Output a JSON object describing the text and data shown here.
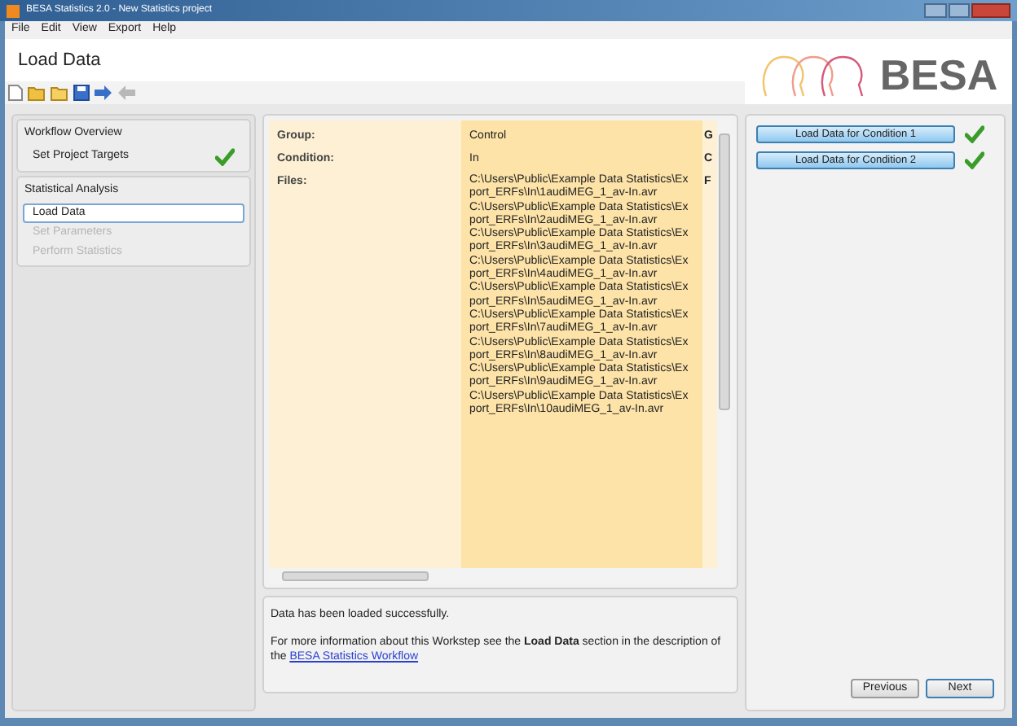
{
  "window": {
    "title": "BESA Statistics 2.0 - New Statistics project"
  },
  "menu": [
    "File",
    "Edit",
    "View",
    "Export",
    "Help"
  ],
  "header": {
    "title": "Load Data",
    "logo": "BESA"
  },
  "sidebar": [
    {
      "label": "Workflow Overview",
      "items": [
        {
          "label": "Set Project Targets",
          "selected": false,
          "disabled": false,
          "done": true
        }
      ]
    },
    {
      "label": "Statistical Analysis",
      "items": [
        {
          "label": "Load Data",
          "selected": true,
          "disabled": false,
          "done": false
        },
        {
          "label": "Set Parameters",
          "selected": false,
          "disabled": true,
          "done": false
        },
        {
          "label": "Perform Statistics",
          "selected": false,
          "disabled": true,
          "done": false
        }
      ]
    }
  ],
  "table": {
    "rows": [
      {
        "label": "Group:",
        "value": "Control",
        "column_3": "G"
      },
      {
        "label": "Condition:",
        "value": "In",
        "column_3": "C"
      },
      {
        "label": "Files:",
        "files": [
          "C:\\Users\\Public\\Example Data Statistics\\Export_ERFs\\In\\1audiMEG_1_av-In.avr",
          "C:\\Users\\Public\\Example Data Statistics\\Export_ERFs\\In\\2audiMEG_1_av-In.avr",
          "C:\\Users\\Public\\Example Data Statistics\\Export_ERFs\\In\\3audiMEG_1_av-In.avr",
          "C:\\Users\\Public\\Example Data Statistics\\Export_ERFs\\In\\4audiMEG_1_av-In.avr",
          "C:\\Users\\Public\\Example Data Statistics\\Export_ERFs\\In\\5audiMEG_1_av-In.avr",
          "C:\\Users\\Public\\Example Data Statistics\\Export_ERFs\\In\\7audiMEG_1_av-In.avr",
          "C:\\Users\\Public\\Example Data Statistics\\Export_ERFs\\In\\8audiMEG_1_av-In.avr",
          "C:\\Users\\Public\\Example Data Statistics\\Export_ERFs\\In\\9audiMEG_1_av-In.avr",
          "C:\\Users\\Public\\Example Data Statistics\\Export_ERFs\\In\\10audiMEG_1_av-In.avr"
        ],
        "column_3": "F"
      }
    ]
  },
  "message": {
    "status": "Data has been loaded successfully.",
    "info": "For more information about this Workstep see the **Load Data** section in the description of the",
    "link": "BESA Statistics Workflow"
  },
  "conditions": [
    {
      "label": "Load Data for Condition 1",
      "done": true
    },
    {
      "label": "Load Data for Condition 2",
      "done": true
    }
  ],
  "buttons": [
    "Previous",
    "Next"
  ]
}
